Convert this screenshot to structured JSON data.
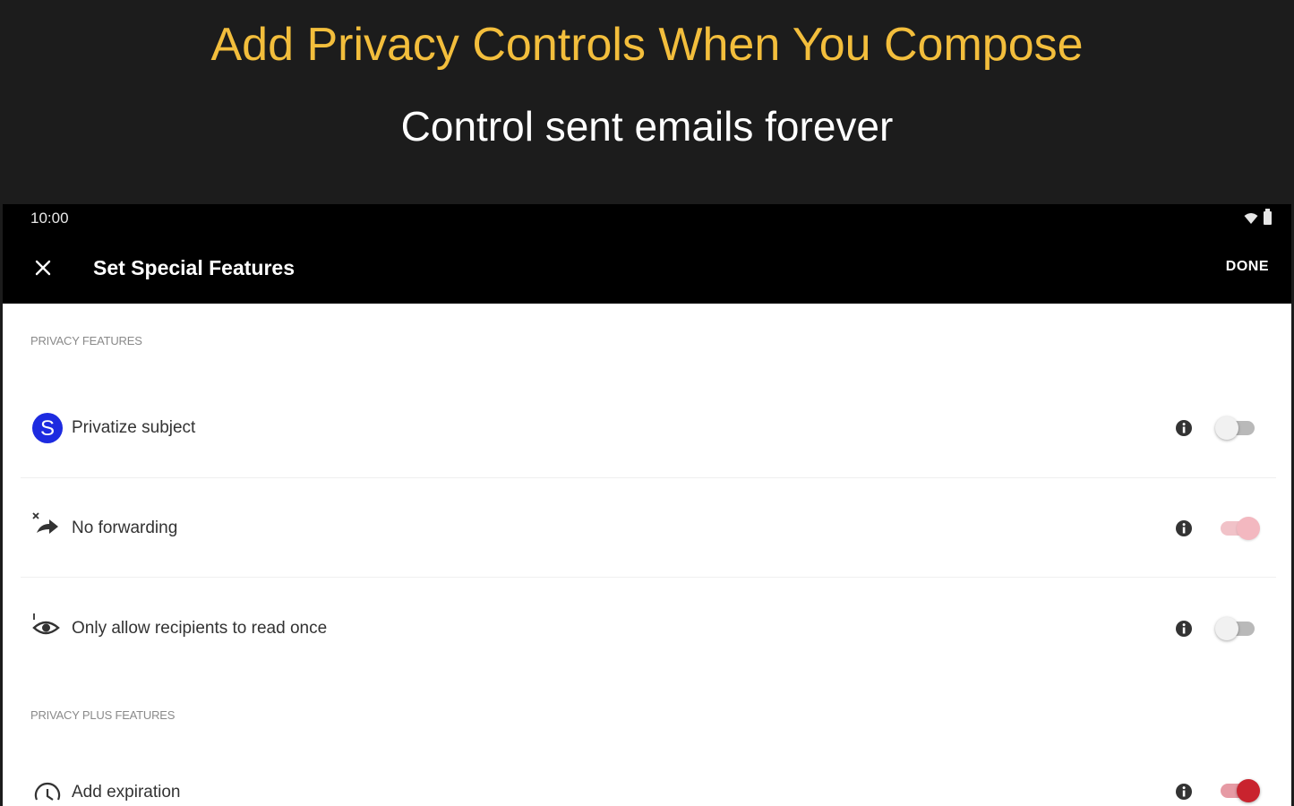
{
  "promo": {
    "title": "Add Privacy Controls When You Compose",
    "subtitle": "Control sent emails forever"
  },
  "status_bar": {
    "time": "10:00",
    "icons": [
      "wifi-icon",
      "battery-icon"
    ]
  },
  "app_bar": {
    "close_icon": "close-icon",
    "title": "Set Special Features",
    "done_label": "DONE"
  },
  "sections": [
    {
      "header": "PRIVACY FEATURES",
      "items": [
        {
          "label": "Privatize subject",
          "icon": "privatize-subject-icon",
          "enabled": false
        },
        {
          "label": "No forwarding",
          "icon": "no-forwarding-icon",
          "enabled": true
        },
        {
          "label": "Only allow recipients to read once",
          "icon": "read-once-icon",
          "enabled": false
        }
      ]
    },
    {
      "header": "PRIVACY PLUS FEATURES",
      "items": [
        {
          "label": "Add expiration",
          "icon": "expiration-icon",
          "enabled": true
        }
      ]
    }
  ],
  "colors": {
    "promo_title": "#f3be3c",
    "toggle_on": "#c9232e",
    "subject_icon": "#1d2be0"
  }
}
